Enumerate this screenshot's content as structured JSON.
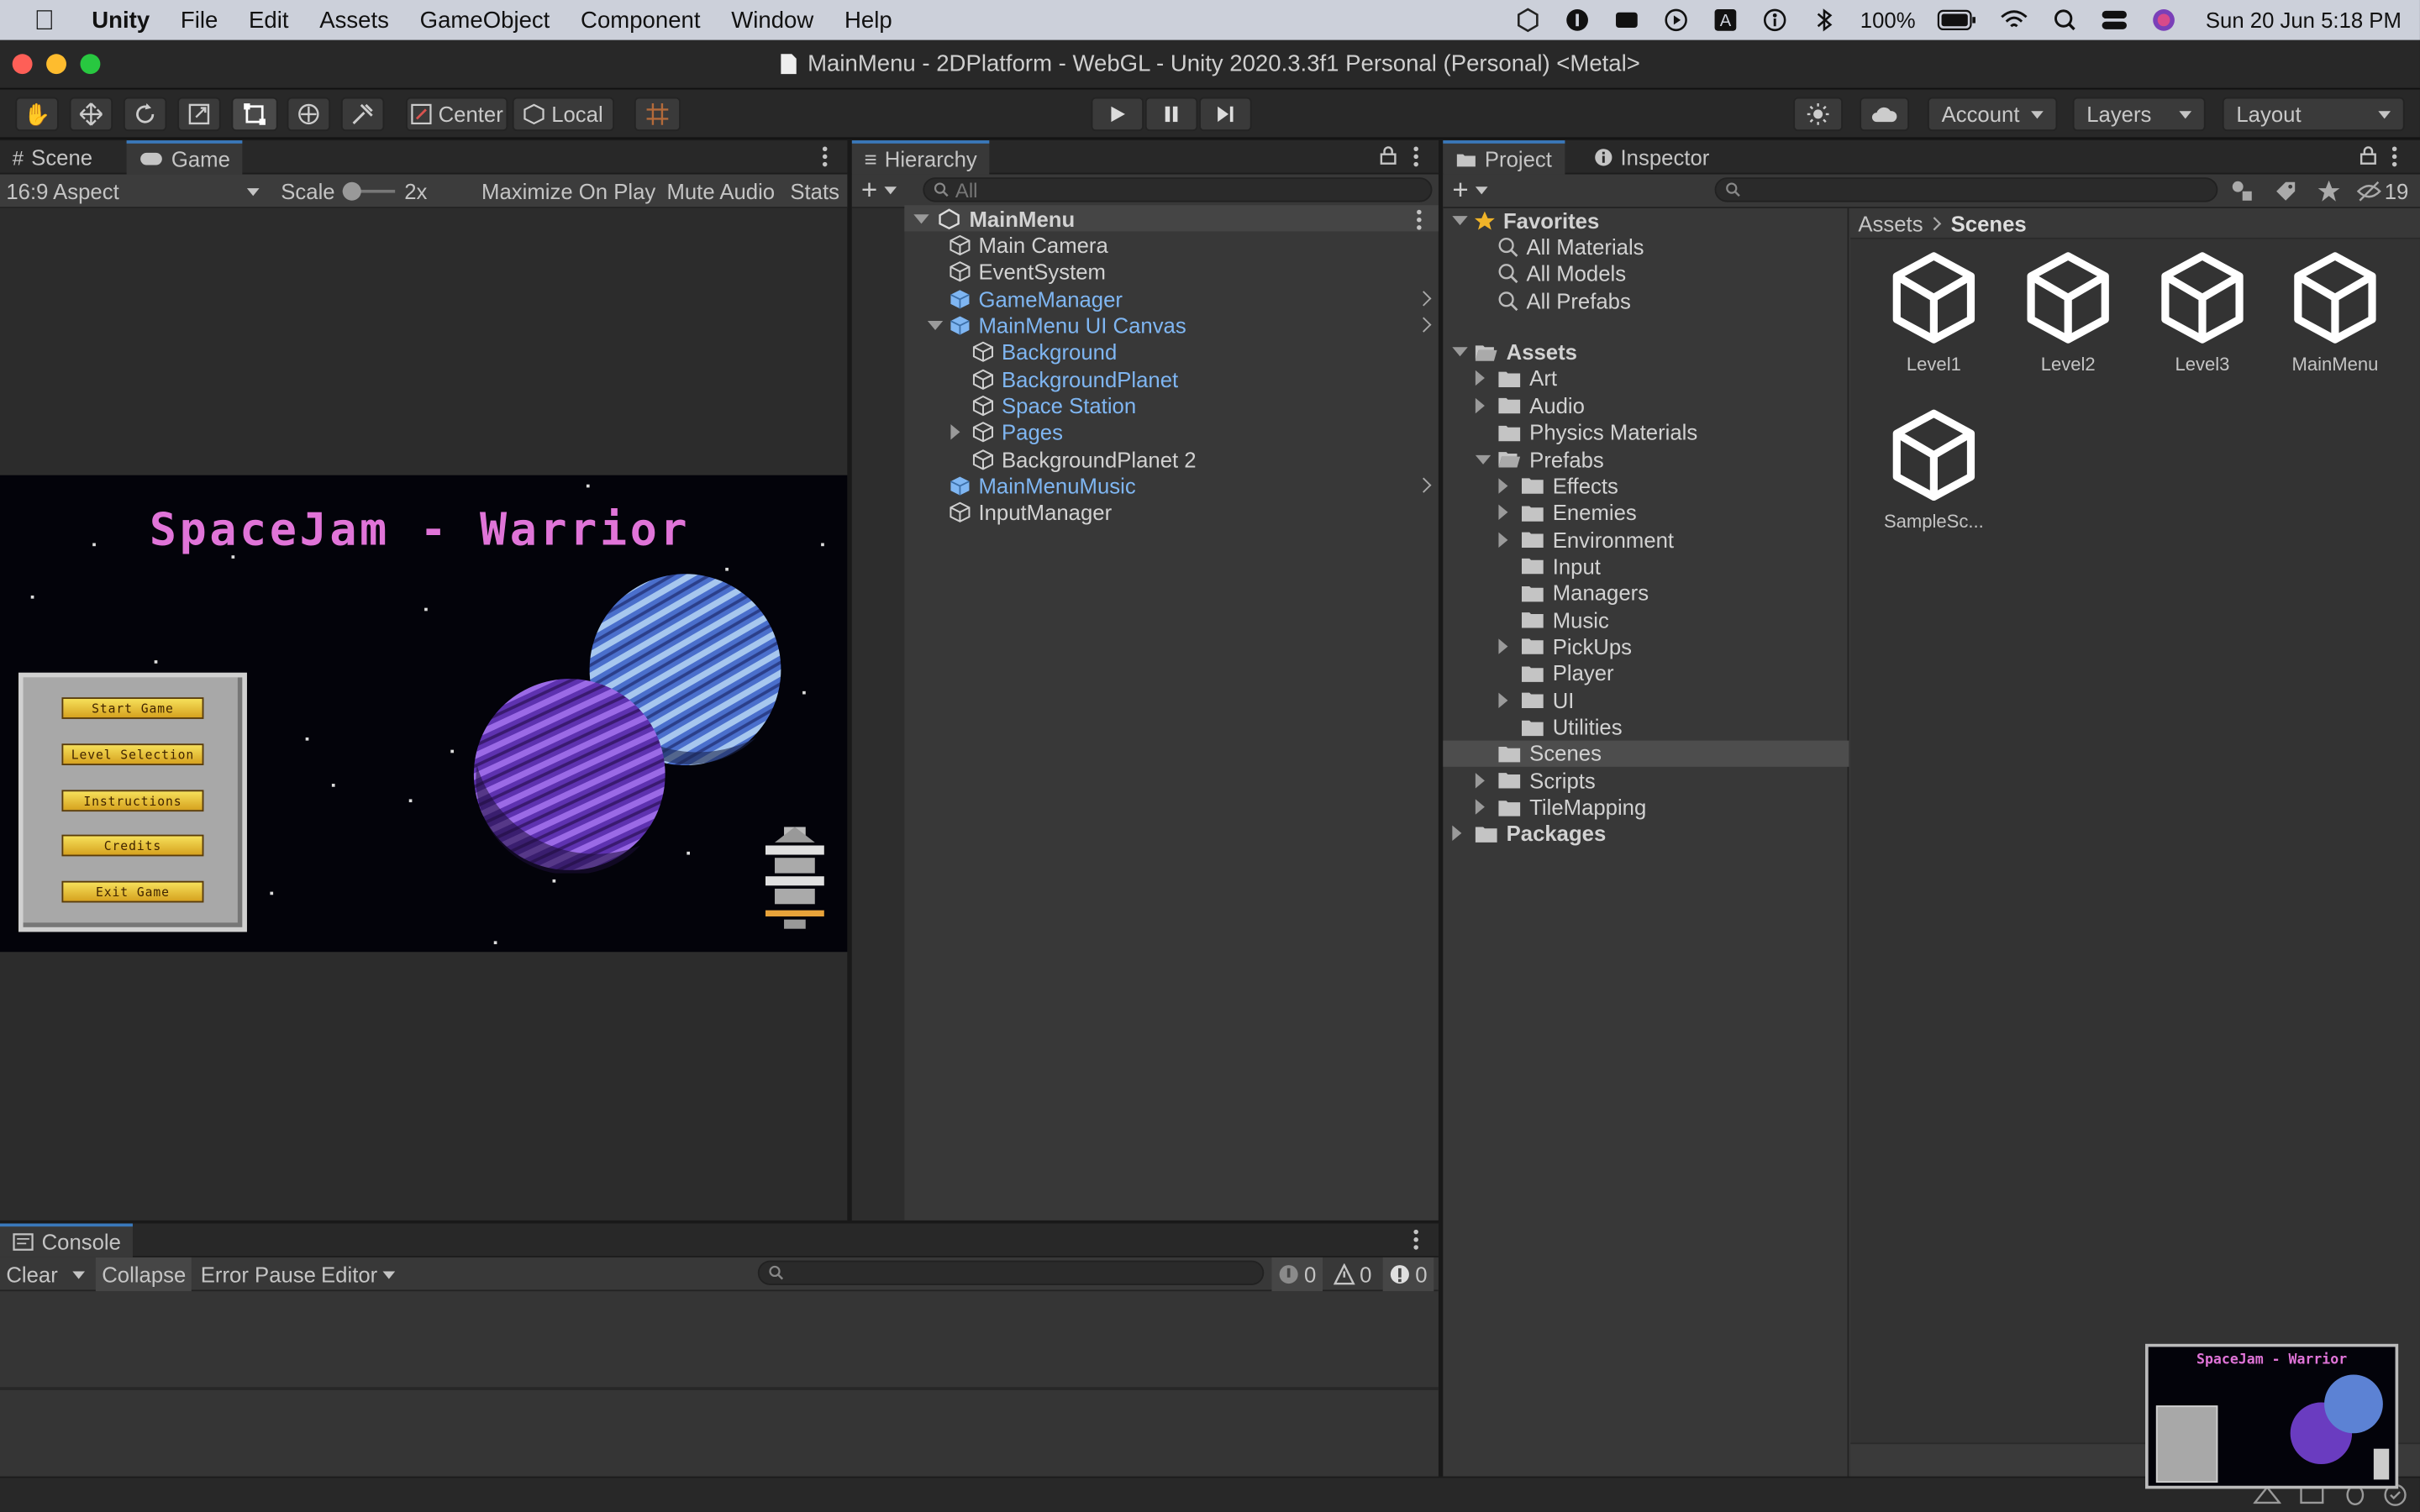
{
  "menubar": {
    "app": "Unity",
    "items": [
      "File",
      "Edit",
      "Assets",
      "GameObject",
      "Component",
      "Window",
      "Help"
    ],
    "battery": "100%",
    "datetime": "Sun 20 Jun  5:18 PM"
  },
  "window": {
    "title": "MainMenu - 2DPlatform - WebGL - Unity 2020.3.3f1 Personal (Personal) <Metal>"
  },
  "toolbar": {
    "pivot_label": "Center",
    "space_label": "Local",
    "account_label": "Account",
    "layers_label": "Layers",
    "layout_label": "Layout"
  },
  "game_panel": {
    "tabs": [
      "Scene",
      "Game"
    ],
    "aspect": "16:9 Aspect",
    "scale_label": "Scale",
    "scale_value": "2x",
    "buttons": [
      "Maximize On Play",
      "Mute Audio",
      "Stats"
    ],
    "game": {
      "title": "SpaceJam - Warrior",
      "menu_buttons": [
        "Start Game",
        "Level Selection",
        "Instructions",
        "Credits",
        "Exit Game"
      ]
    }
  },
  "hierarchy": {
    "tab": "Hierarchy",
    "search_placeholder": "All",
    "root": "MainMenu",
    "items": [
      "Main Camera",
      "EventSystem",
      "GameManager",
      "MainMenu UI Canvas",
      "Background",
      "BackgroundPlanet",
      "Space Station",
      "Pages",
      "BackgroundPlanet 2",
      "MainMenuMusic",
      "InputManager"
    ]
  },
  "project": {
    "tabs": [
      "Project",
      "Inspector"
    ],
    "hidden_count": "19",
    "favorites_label": "Favorites",
    "favorites": [
      "All Materials",
      "All Models",
      "All Prefabs"
    ],
    "assets_label": "Assets",
    "assets": [
      "Art",
      "Audio",
      "Physics Materials",
      "Prefabs"
    ],
    "prefabs": [
      "Effects",
      "Enemies",
      "Environment",
      "Input",
      "Managers",
      "Music",
      "PickUps",
      "Player",
      "UI",
      "Utilities"
    ],
    "assets_after": [
      "Scenes",
      "Scripts",
      "TileMapping"
    ],
    "packages_label": "Packages",
    "breadcrumb": [
      "Assets",
      "Scenes"
    ],
    "scene_files": [
      "Level1",
      "Level2",
      "Level3",
      "MainMenu",
      "SampleSc..."
    ]
  },
  "console": {
    "tab": "Console",
    "buttons": [
      "Clear",
      "Collapse",
      "Error Pause",
      "Editor"
    ],
    "counts": {
      "log": "0",
      "warn": "0",
      "error": "0"
    }
  },
  "colors": {
    "accent": "#3a79bb",
    "prefab_blue": "#7fb6f2",
    "selected_row": "#4d4d4d"
  }
}
